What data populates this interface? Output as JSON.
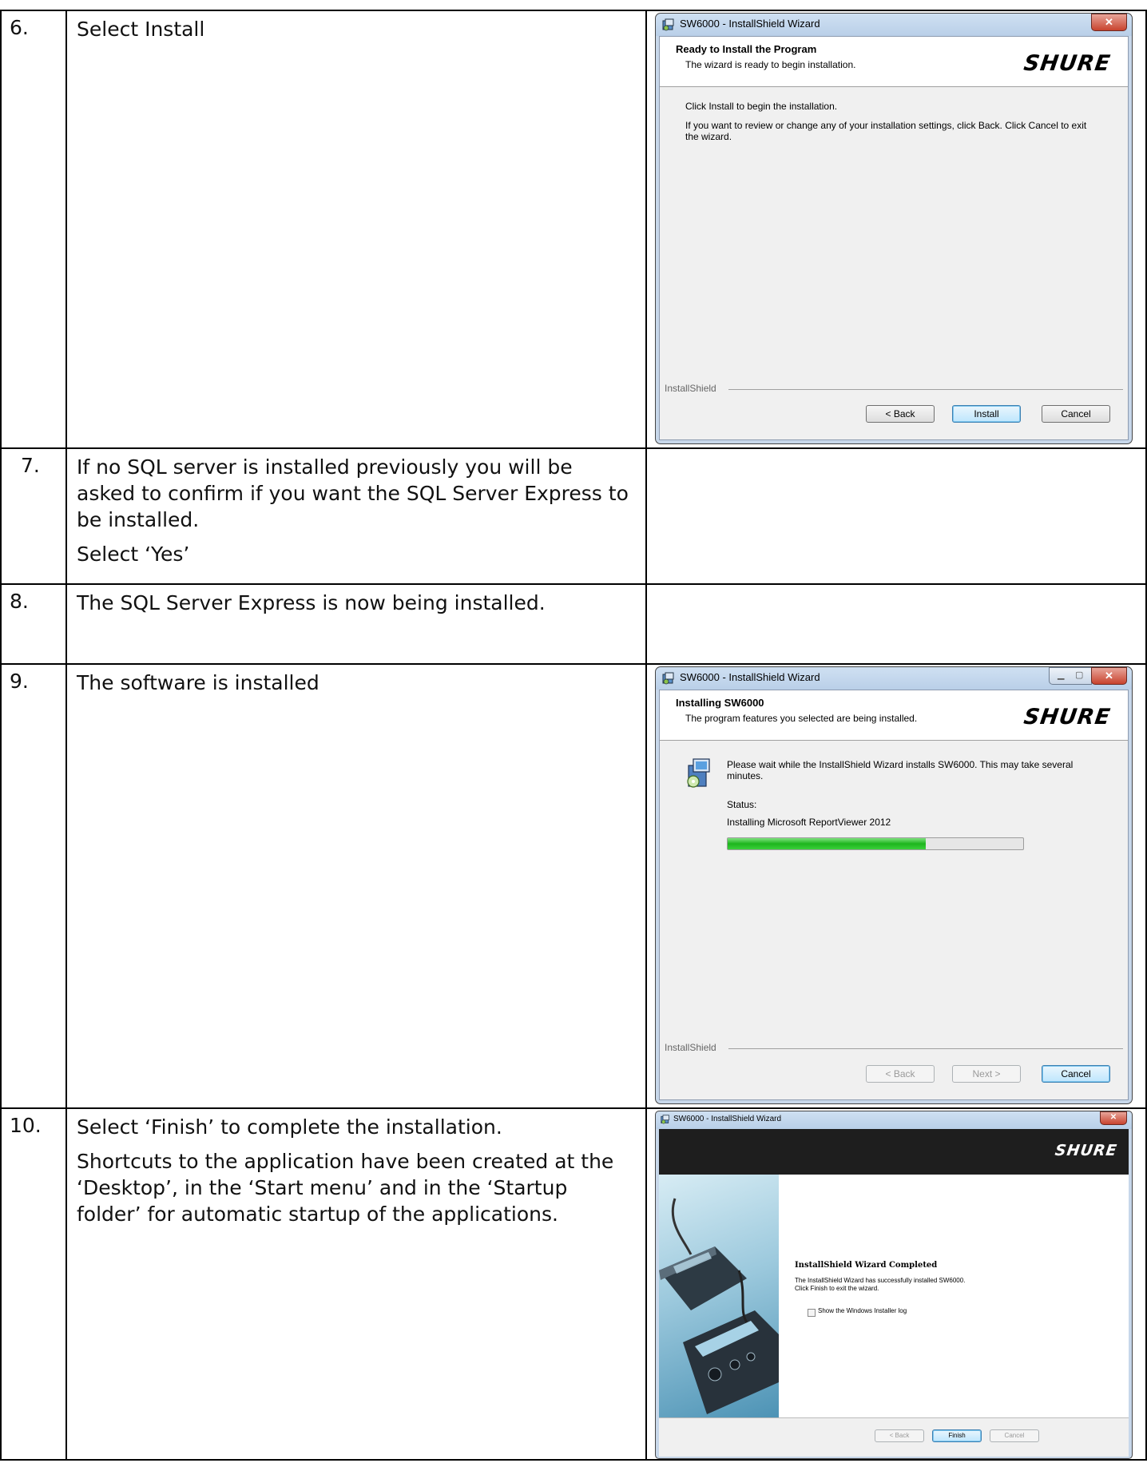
{
  "steps": [
    {
      "num": "6.",
      "text": [
        "Select Install"
      ]
    },
    {
      "num": "7.",
      "text": [
        "If no SQL server is installed previously you will be asked to confirm if you want the SQL Server Express to be installed.",
        "Select ‘Yes’"
      ]
    },
    {
      "num": "8.",
      "text": [
        "The SQL Server Express is now being installed."
      ]
    },
    {
      "num": "9.",
      "text": [
        "The software is installed"
      ]
    },
    {
      "num": "10.",
      "text": [
        "Select ‘Finish’ to complete the installation.",
        "Shortcuts to the application have been created at the ‘Desktop’, in the ‘Start menu’ and in the ‘Startup folder’ for automatic startup of the applications."
      ]
    }
  ],
  "dialog1": {
    "title": "SW6000 - InstallShield Wizard",
    "heading": "Ready to Install the Program",
    "subheading": "The wizard is ready to begin installation.",
    "logo": "SHURE",
    "line1": "Click Install to begin the installation.",
    "line2": "If you want to review or change any of your installation settings, click Back. Click Cancel to exit the wizard.",
    "brand": "InstallShield",
    "back": "< Back",
    "install": "Install",
    "cancel": "Cancel"
  },
  "dialog2": {
    "title": "SW6000 - InstallShield Wizard",
    "heading": "Installing SW6000",
    "subheading": "The program features you selected are being installed.",
    "logo": "SHURE",
    "wait": "Please wait while the InstallShield Wizard installs SW6000. This may take several minutes.",
    "status_label": "Status:",
    "status_value": "Installing Microsoft ReportViewer 2012",
    "progress": 0.67,
    "brand": "InstallShield",
    "back": "< Back",
    "next": "Next >",
    "cancel": "Cancel"
  },
  "dialog3": {
    "title": "SW6000 - InstallShield Wizard",
    "logo": "SHURE",
    "heading": "InstallShield Wizard Completed",
    "line1": "The InstallShield Wizard has successfully installed SW6000.",
    "line2": "Click Finish to exit the wizard.",
    "checkbox": "Show the Windows Installer log",
    "back": "< Back",
    "finish": "Finish",
    "cancel": "Cancel"
  }
}
